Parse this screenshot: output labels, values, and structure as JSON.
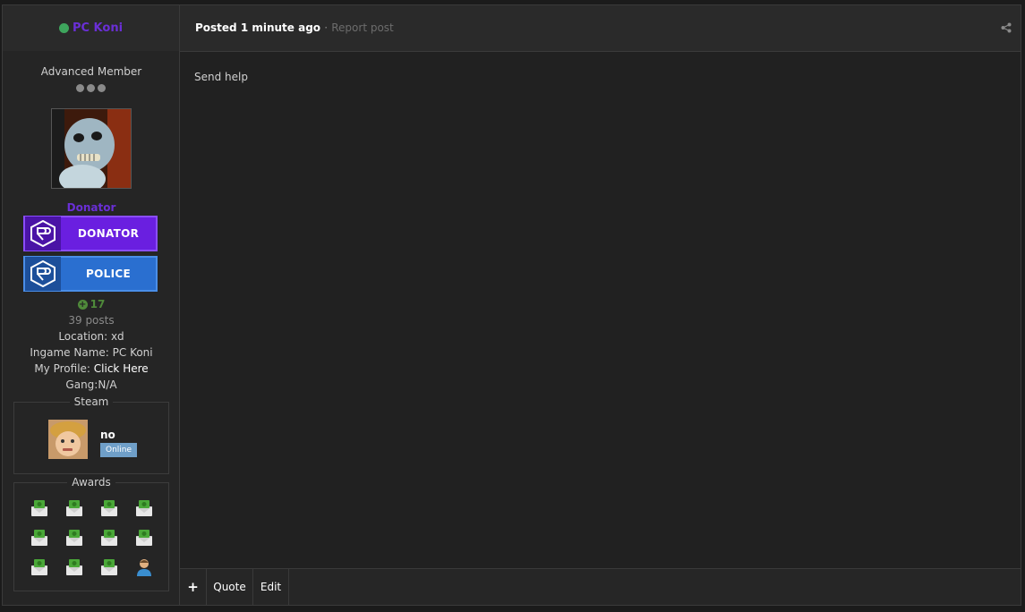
{
  "author": {
    "name": "PC Koni",
    "online": true,
    "status_color": "#3ea55d",
    "name_color": "#6a2fd6"
  },
  "meta": {
    "posted_label": "Posted 1 minute ago",
    "separator": "·",
    "report_label": "Report post"
  },
  "sidebar": {
    "rank_title": "Advanced Member",
    "group_name": "Donator",
    "badges": [
      {
        "label": "DONATOR",
        "color": "#6a1fe0"
      },
      {
        "label": "POLICE",
        "color": "#2a6fd0"
      }
    ],
    "reputation": "17",
    "posts": "39 posts",
    "location_label": "Location: ",
    "location_value": "xd",
    "ingame_label": "Ingame Name: ",
    "ingame_value": "PC Koni",
    "profile_label": "My Profile: ",
    "profile_link": "Click Here",
    "gang_label": "Gang:",
    "gang_value": "N/A",
    "steam": {
      "legend": "Steam",
      "name": "no",
      "status": "Online"
    },
    "awards": {
      "legend": "Awards",
      "items": [
        "money-envelope-icon",
        "money-envelope-icon",
        "money-envelope-icon",
        "money-envelope-icon",
        "money-envelope-icon",
        "money-envelope-icon",
        "money-envelope-icon",
        "money-envelope-icon",
        "money-envelope-icon",
        "money-envelope-icon",
        "money-envelope-icon",
        "person-icon"
      ]
    }
  },
  "post": {
    "body": "Send help"
  },
  "actions": {
    "plus_label": "+",
    "quote_label": "Quote",
    "edit_label": "Edit"
  }
}
